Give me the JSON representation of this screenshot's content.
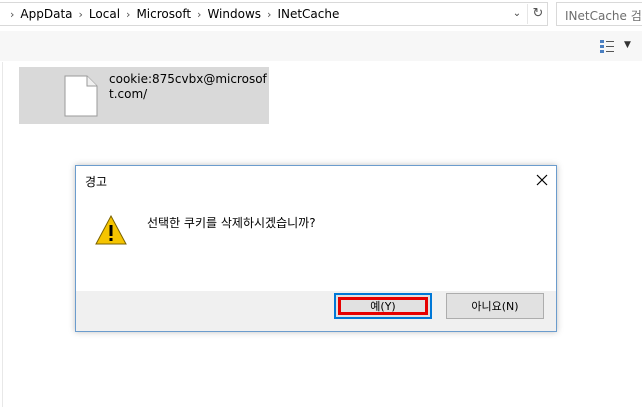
{
  "address_bar": {
    "breadcrumbs": [
      "AppData",
      "Local",
      "Microsoft",
      "Windows",
      "INetCache"
    ],
    "search_placeholder": "INetCache 검색"
  },
  "file_list": {
    "items": [
      {
        "name": "cookie:875cvbx@microsoft.com/",
        "icon": "blank-file-icon"
      }
    ]
  },
  "dialog": {
    "title": "경고",
    "message": "선택한 쿠키를 삭제하시겠습니까?",
    "icon": "warning-icon",
    "yes_label": "예(Y)",
    "no_label": "아니요(N)",
    "highlight_color": "#e60000"
  }
}
